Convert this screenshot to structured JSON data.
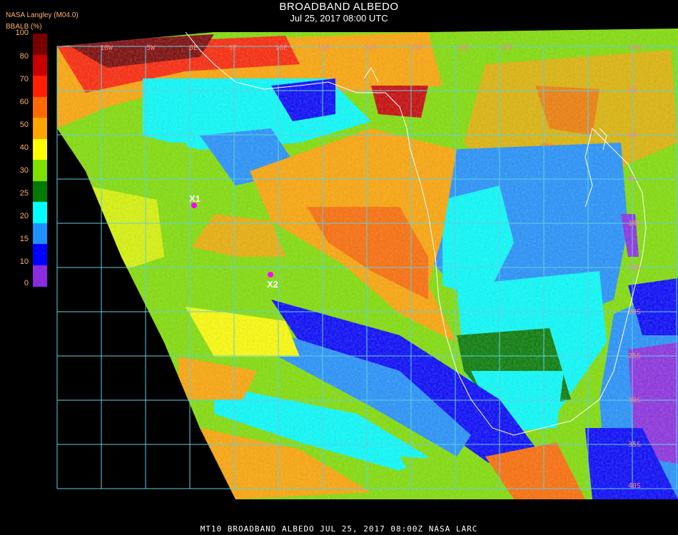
{
  "header": {
    "title": "BROADBAND ALBEDO",
    "subtitle": "Jul 25, 2017 08:00 UTC",
    "org": "NASA Langley (M04.0)",
    "unit": "BBALB (%)"
  },
  "colorbar": {
    "ticks": [
      "100",
      "80",
      "70",
      "60",
      "50",
      "40",
      "30",
      "25",
      "20",
      "15",
      "10",
      "0"
    ],
    "colors": [
      "#7a0000",
      "#c80000",
      "#ff2000",
      "#ff6a00",
      "#ffa500",
      "#ffff00",
      "#7fe000",
      "#007a00",
      "#00ffff",
      "#1e90ff",
      "#0000ff",
      "#8a2be2"
    ]
  },
  "map": {
    "lon_labels": [
      "10W",
      "5W",
      "0E",
      "5E",
      "10E",
      "15E",
      "20E",
      "25E",
      "30E",
      "35E"
    ],
    "lat_labels": [
      "10N",
      "5N",
      "0N",
      "5S",
      "10S",
      "15S",
      "20S",
      "25S",
      "30S",
      "35S",
      "40S"
    ],
    "markers": [
      {
        "label": "X1"
      },
      {
        "label": "X2"
      }
    ],
    "colors": {
      "grid": "#5fd0e0",
      "coast": "#ffffff",
      "marker": "#ff00ff",
      "space": "#000000"
    }
  },
  "footer": {
    "text": "MT10  BROADBAND ALBEDO   JUL 25, 2017 08:00Z   NASA LARC"
  }
}
